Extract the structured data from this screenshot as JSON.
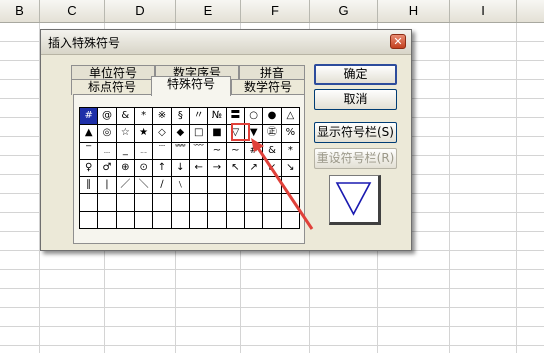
{
  "sheet": {
    "columns": [
      "B",
      "C",
      "D",
      "E",
      "F",
      "G",
      "H",
      "I"
    ]
  },
  "dialog": {
    "title": "插入特殊符号",
    "close_glyph": "✕",
    "tabs": [
      {
        "label": "单位符号",
        "active": false
      },
      {
        "label": "数字序号",
        "active": false
      },
      {
        "label": "拼音",
        "active": false
      },
      {
        "label": "标点符号",
        "active": false
      },
      {
        "label": "特殊符号",
        "active": true
      },
      {
        "label": "数学符号",
        "active": false
      }
    ],
    "symbols": [
      "#",
      "@",
      "&",
      "*",
      "※",
      "§",
      "〃",
      "№",
      "〓",
      "○",
      "●",
      "△",
      "▲",
      "◎",
      "☆",
      "★",
      "◇",
      "◆",
      "□",
      "■",
      "▽",
      "▼",
      "㊣",
      "%",
      "‾",
      "﹍",
      "_",
      "﹎",
      "﹉",
      "﹌",
      "﹋",
      "~",
      "~",
      "#",
      "&",
      "*",
      "♀",
      "♂",
      "⊕",
      "⊙",
      "↑",
      "↓",
      "←",
      "→",
      "↖",
      "↗",
      "↙",
      "↘",
      "∥",
      "|",
      "／",
      "＼",
      "∕",
      "﹨",
      "",
      "",
      "",
      "",
      "",
      "",
      "",
      "",
      "",
      "",
      "",
      "",
      "",
      "",
      "",
      "",
      "",
      "",
      "",
      "",
      "",
      "",
      "",
      "",
      "",
      "",
      "",
      "",
      "",
      ""
    ],
    "selected_symbol": "#",
    "buttons": {
      "ok": "确定",
      "cancel": "取消",
      "show_toolbar": "显示符号栏(S)",
      "reset_toolbar": "重设符号栏(R)"
    },
    "preview_symbol_icon": "triangle-down-outline",
    "colors": {
      "selection": "#1e2fa8",
      "annotation_arrow": "#e0413a",
      "annotation_box": "#e0413a",
      "preview_triangle": "#1a1ab0"
    }
  }
}
